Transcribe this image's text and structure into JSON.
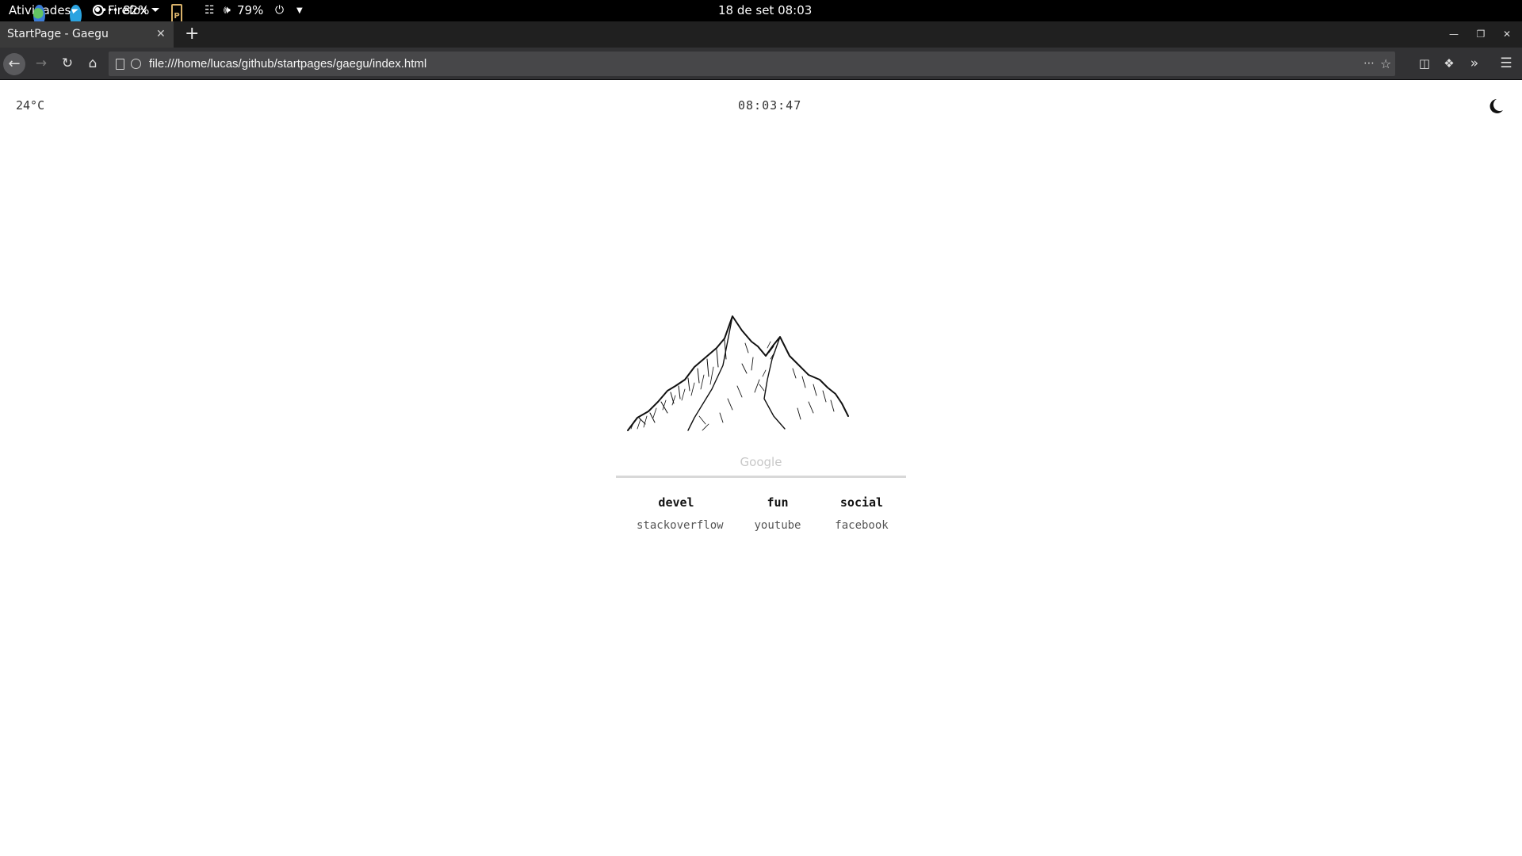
{
  "topbar": {
    "activities": "Atividades",
    "app_menu": "Firefox",
    "clock": "18 de set  08:03",
    "tray_dots": "•••",
    "battery_a": "82%",
    "p_icon": "P",
    "battery_b": "79%"
  },
  "browser": {
    "tab_title": "StartPage - Gaegu",
    "url": "file:///home/lucas/github/startpages/gaegu/index.html"
  },
  "startpage": {
    "temperature": "24°C",
    "time": "08:03:47",
    "search_placeholder": "Google",
    "columns": [
      {
        "heading": "devel",
        "link": "stackoverflow"
      },
      {
        "heading": "fun",
        "link": "youtube"
      },
      {
        "heading": "social",
        "link": "facebook"
      }
    ]
  },
  "colors": {
    "topbar_bg": "#000000",
    "tabstrip_bg": "#202020",
    "toolbar_bg": "#323234",
    "urlbar_bg": "#474749",
    "page_bg": "#ffffff",
    "search_line": "#d8d8d8"
  },
  "icons": [
    "firefox-icon",
    "globe-icon",
    "telegram-icon",
    "volume-icon",
    "network-icon",
    "power-icon",
    "moon-icon"
  ]
}
